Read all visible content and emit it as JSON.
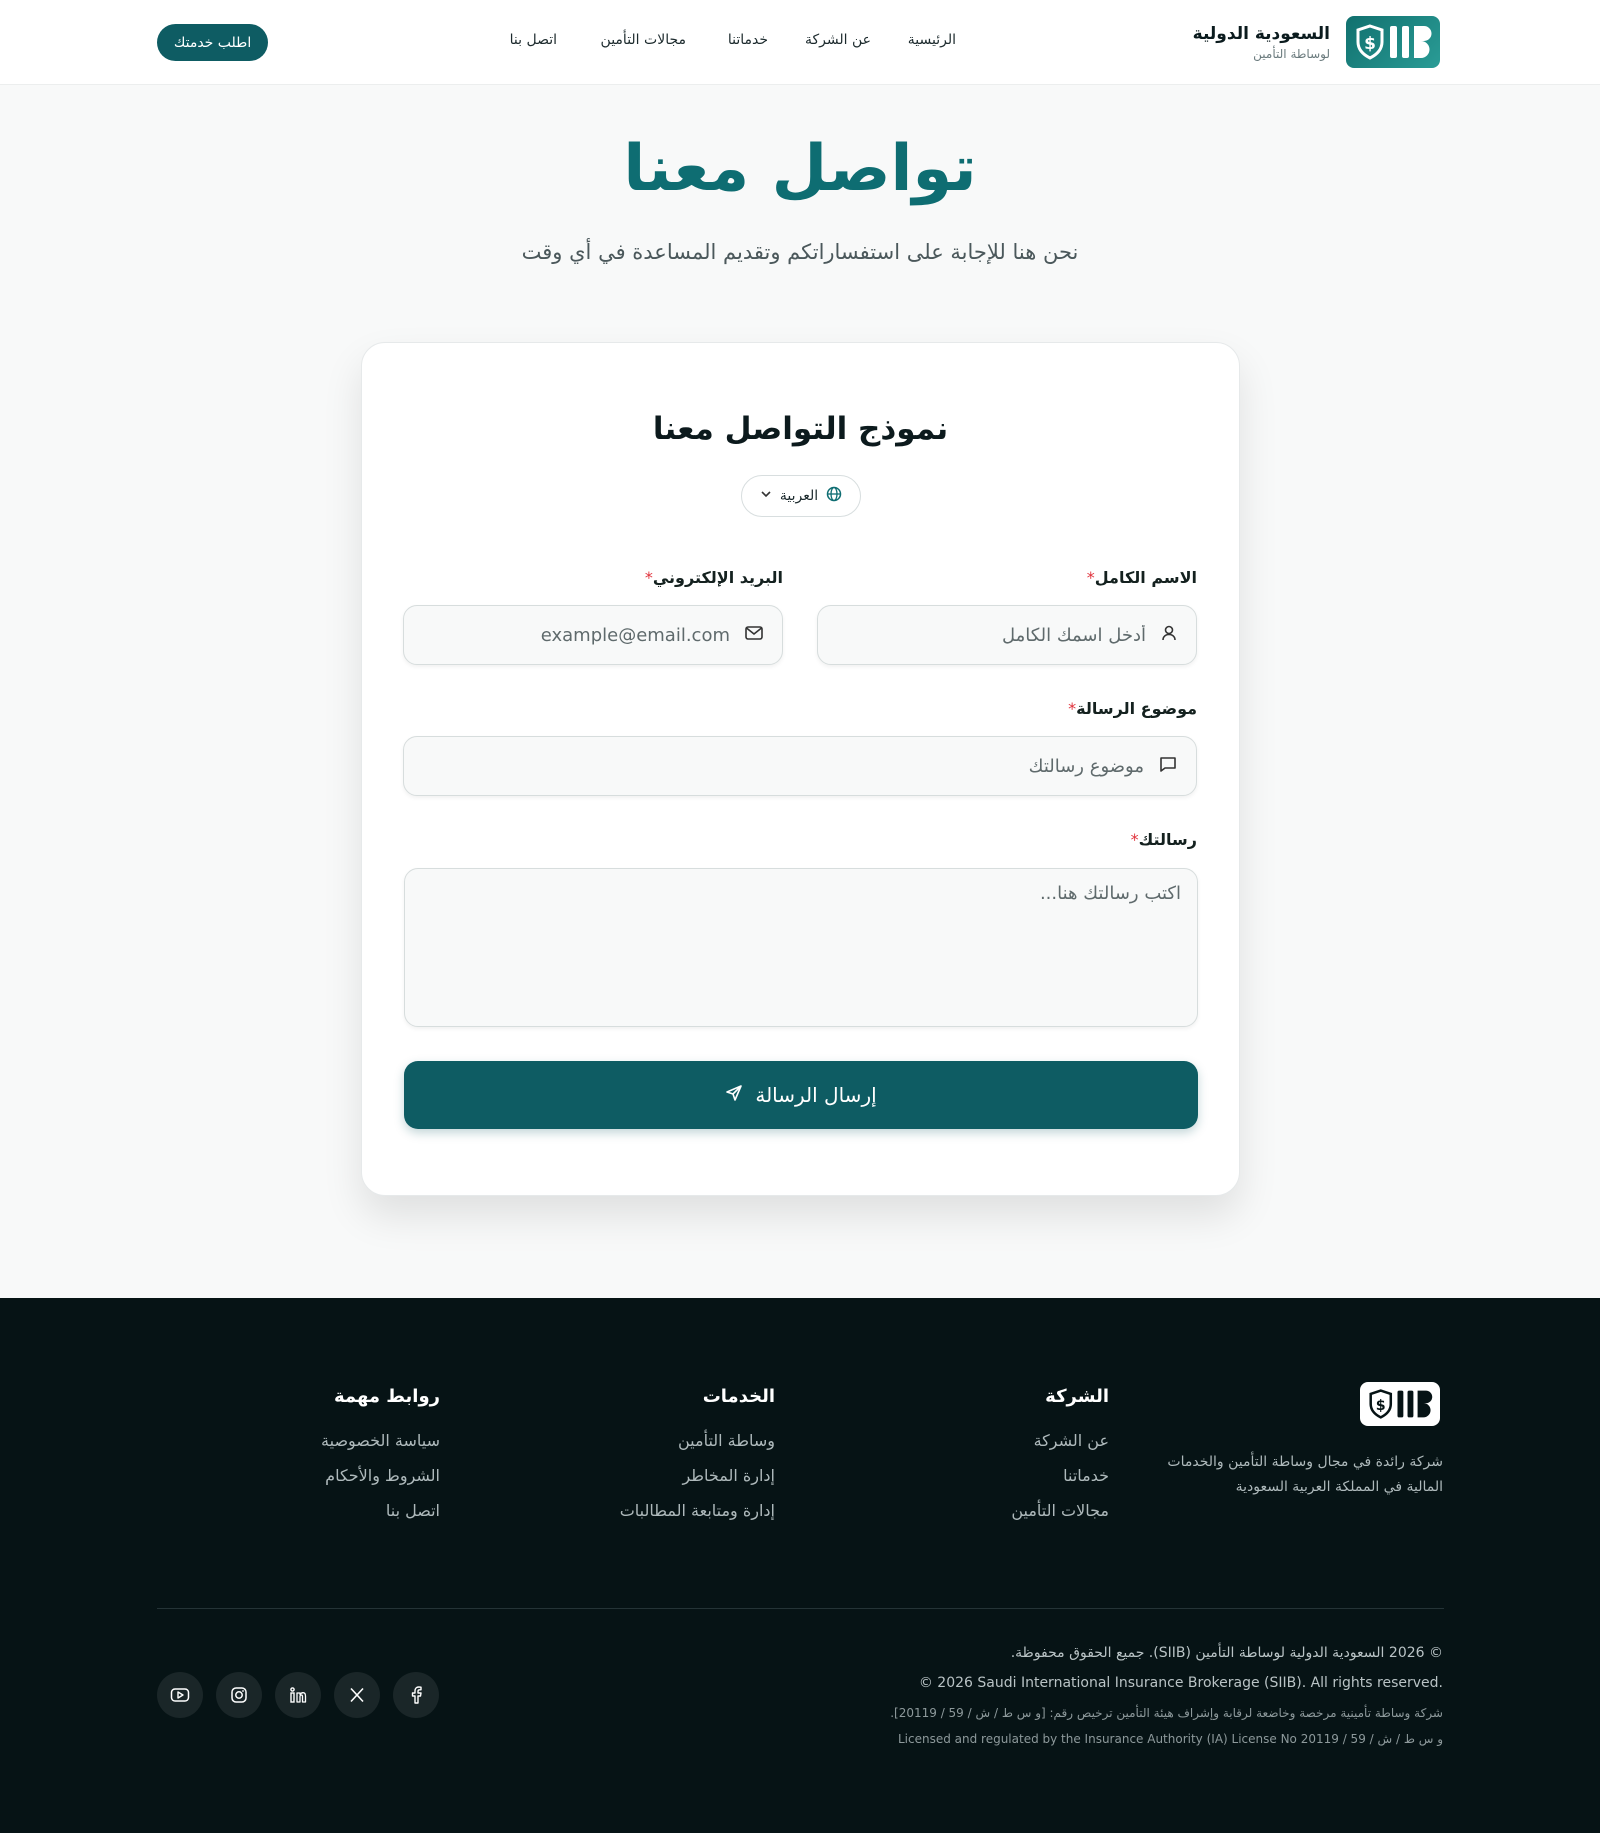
{
  "header": {
    "brand_name": "السعودية الدولية",
    "brand_sub": "لوساطة التأمين",
    "nav": [
      "الرئيسية",
      "عن الشركة",
      "خدماتنا",
      "مجالات التأمين",
      "اتصل بنا"
    ],
    "cta_label": "اطلب خدمتك"
  },
  "hero": {
    "title": "تواصل معنا",
    "subtitle": "نحن هنا للإجابة على استفساراتكم وتقديم المساعدة في أي وقت"
  },
  "form": {
    "title": "نموذج التواصل معنا",
    "language": "العربية",
    "name_label": "الاسم الكامل",
    "name_placeholder": "أدخل اسمك الكامل",
    "email_label": "البريد الإلكتروني",
    "email_placeholder": "example@email.com",
    "subject_label": "موضوع الرسالة",
    "subject_placeholder": "موضوع رسالتك",
    "message_label": "رسالتك",
    "message_placeholder": "اكتب رسالتك هنا...",
    "required_mark": "*",
    "submit_label": "إرسال الرسالة"
  },
  "footer": {
    "description": "شركة رائدة في مجال وساطة التأمين والخدمات المالية في المملكة العربية السعودية",
    "company": {
      "heading": "الشركة",
      "links": [
        "عن الشركة",
        "خدماتنا",
        "مجالات التأمين"
      ]
    },
    "services": {
      "heading": "الخدمات",
      "links": [
        "وساطة التأمين",
        "إدارة المخاطر",
        "إدارة ومتابعة المطالبات"
      ]
    },
    "important": {
      "heading": "روابط مهمة",
      "links": [
        "سياسة الخصوصية",
        "الشروط والأحكام",
        "اتصل بنا"
      ]
    },
    "copyright_ar": "© 2026 السعودية الدولية لوساطة التأمين (SIIB). جميع الحقوق محفوظة.",
    "copyright_en": "© 2026 Saudi International Insurance Brokerage (SIIB). All rights reserved.",
    "license_ar": "شركة وساطة تأمينية مرخصة وخاضعة لرقابة وإشراف هيئة التأمين ترخيص رقم: [و س ط / ش / 59 / 20119].",
    "license_en": "Licensed and regulated by the Insurance Authority (IA) License No 20119 / 59 / و س ط / ش",
    "socials": [
      "facebook-icon",
      "x-icon",
      "linkedin-icon",
      "instagram-icon",
      "youtube-icon"
    ]
  },
  "colors": {
    "primary": "#0e5c63",
    "title_teal": "#0e6d72",
    "footer_bg": "#061315",
    "required_red": "#e0313b"
  }
}
